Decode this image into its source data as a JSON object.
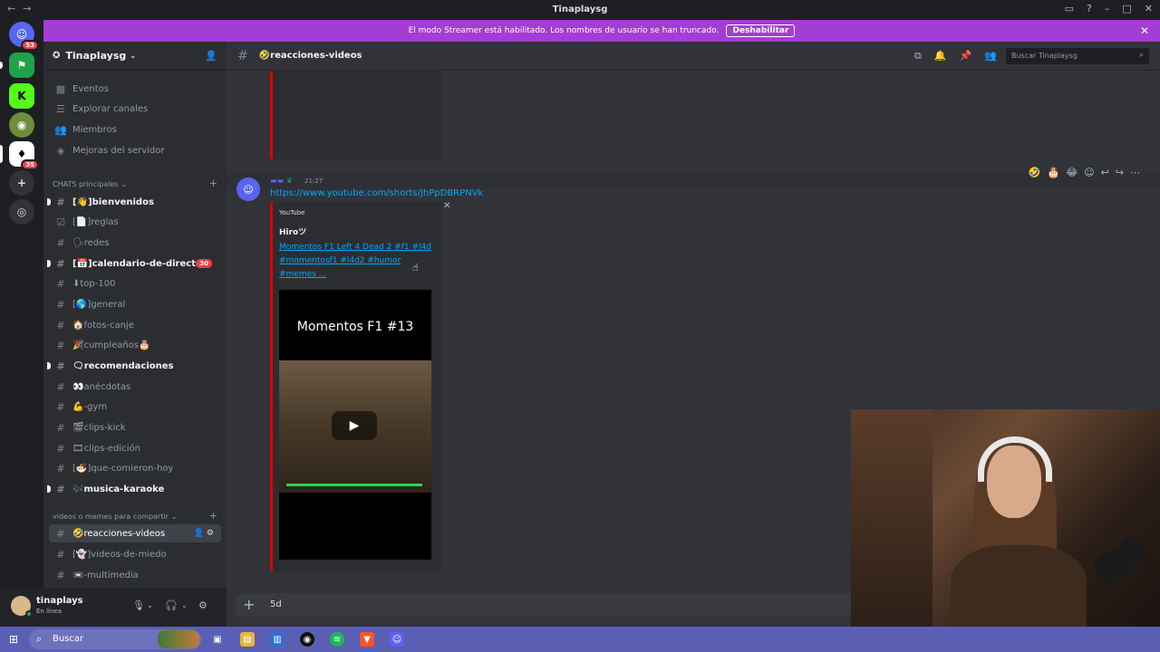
{
  "window": {
    "title": "Tinaplaysg"
  },
  "streamer_banner": {
    "message": "El modo Streamer está habilitado. Los nombres de usuario se han truncado.",
    "button": "Deshabilitar"
  },
  "server_rail": {
    "badges": {
      "first": "53",
      "fifth": "35"
    }
  },
  "server": {
    "name": "Tinaplaysg"
  },
  "sidebar": {
    "top_items": [
      {
        "label": "Eventos",
        "icon": "calendar-icon"
      },
      {
        "label": "Explorar canales",
        "icon": "browse-icon"
      },
      {
        "label": "Miembros",
        "icon": "members-icon"
      },
      {
        "label": "Mejoras del servidor",
        "icon": "boost-icon"
      }
    ],
    "category_main": "CHATS principales",
    "channels": [
      {
        "label": "[👋]bienvenidos"
      },
      {
        "label": "[📄]reglas"
      },
      {
        "label": "🗣redes"
      },
      {
        "label": "[📅]calendario-de-directo",
        "count": "30"
      },
      {
        "label": "⬇top-100"
      },
      {
        "label": "[🌎]general"
      },
      {
        "label": "🏠fotos-canje"
      },
      {
        "label": "🎉cumpleaños🎂"
      },
      {
        "label": "🗨recomendaciones"
      },
      {
        "label": "👀anécdotas"
      },
      {
        "label": "💪-gym"
      },
      {
        "label": "🎬clips-kick"
      },
      {
        "label": "🎞clips-edición"
      },
      {
        "label": "[🍜]que-comieron-hoy"
      },
      {
        "label": "🎶musica-karaoke"
      }
    ],
    "category_videos": "videos o memes para compartir",
    "video_channels": [
      {
        "label": "🤣reacciones-videos"
      },
      {
        "label": "[👻]videos-de-miedo"
      },
      {
        "label": "📼-multimedia"
      }
    ]
  },
  "user": {
    "name": "tinaplays",
    "status": "En línea"
  },
  "channel": {
    "name": "🤣reacciones-videos",
    "search_placeholder": "Buscar Tinaplaysg"
  },
  "message": {
    "time": "21:27",
    "link": "https://www.youtube.com/shorts/JhPpDBRPNVk",
    "embed": {
      "provider": "YouTube",
      "author": "Hiroツ",
      "title": "Momentos F1 Left 4 Dead 2 #f1 #l4d #momentosf1 #l4d2 #humor #memes ...",
      "video_overlay": "Momentos F1 #13"
    }
  },
  "composer": {
    "text": "5d"
  },
  "taskbar": {
    "search_label": "Buscar"
  },
  "colors": {
    "accent": "#5865f2",
    "banner": "#a43cd6",
    "embed_bar": "#e00000",
    "unread_badge": "#f23f43"
  }
}
